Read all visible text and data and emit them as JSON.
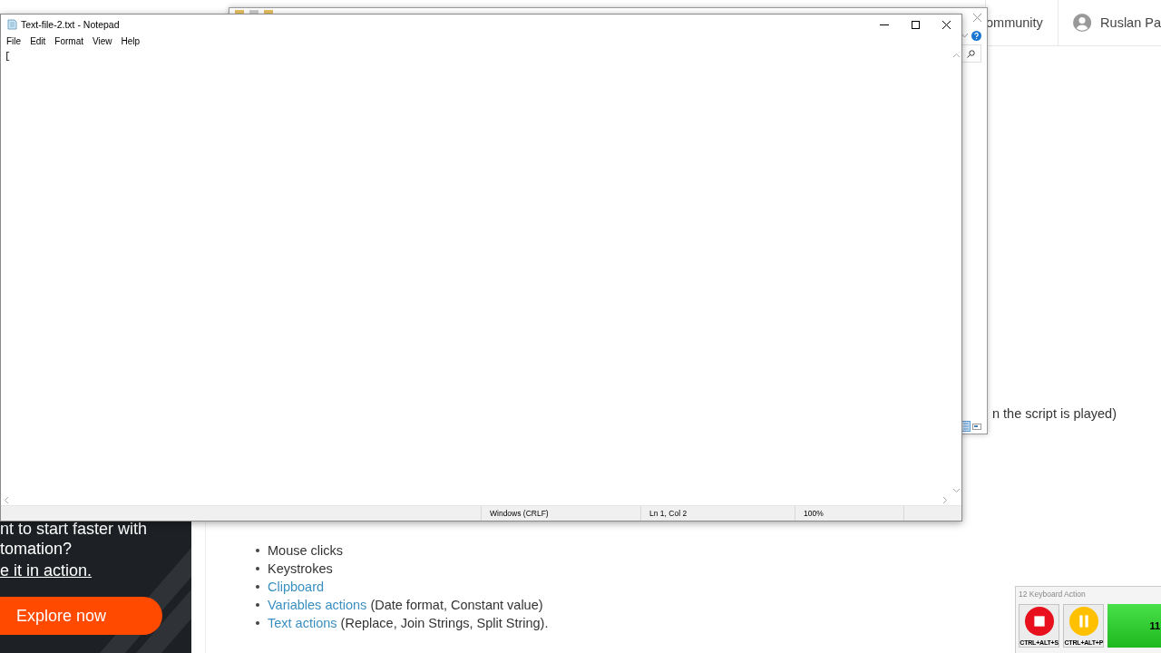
{
  "web_page": {
    "header": {
      "nav_link": "ommunity",
      "user_name": "Ruslan Pa"
    },
    "side_text": "n the script is played)",
    "ad": {
      "lines": [
        "nt to start faster with",
        "tomation?"
      ],
      "link": "e it in action.",
      "button": "Explore now"
    },
    "list": [
      {
        "kind": "plain",
        "text": "Mouse clicks"
      },
      {
        "kind": "plain",
        "text": "Keystrokes"
      },
      {
        "kind": "link",
        "link": "Clipboard"
      },
      {
        "kind": "link",
        "link": "Variables actions",
        "text": "(Date format, Constant value)"
      },
      {
        "kind": "link",
        "link": "Text actions",
        "text": "(Replace, Join Strings, Split String)."
      }
    ]
  },
  "notepad": {
    "title": "Text-file-2.txt - Notepad",
    "menu": [
      "File",
      "Edit",
      "Format",
      "View",
      "Help"
    ],
    "content": "[",
    "status": {
      "line_ending": "Windows (CRLF)",
      "position": "Ln 1, Col 2",
      "zoom": "100%"
    }
  },
  "recorder": {
    "title": "12 Keyboard Action",
    "buttons": [
      {
        "kind": "stop",
        "shortcut": "CTRL+ALT+S"
      },
      {
        "kind": "pause",
        "shortcut": "CTRL+ALT+P"
      }
    ],
    "counter": "11"
  }
}
